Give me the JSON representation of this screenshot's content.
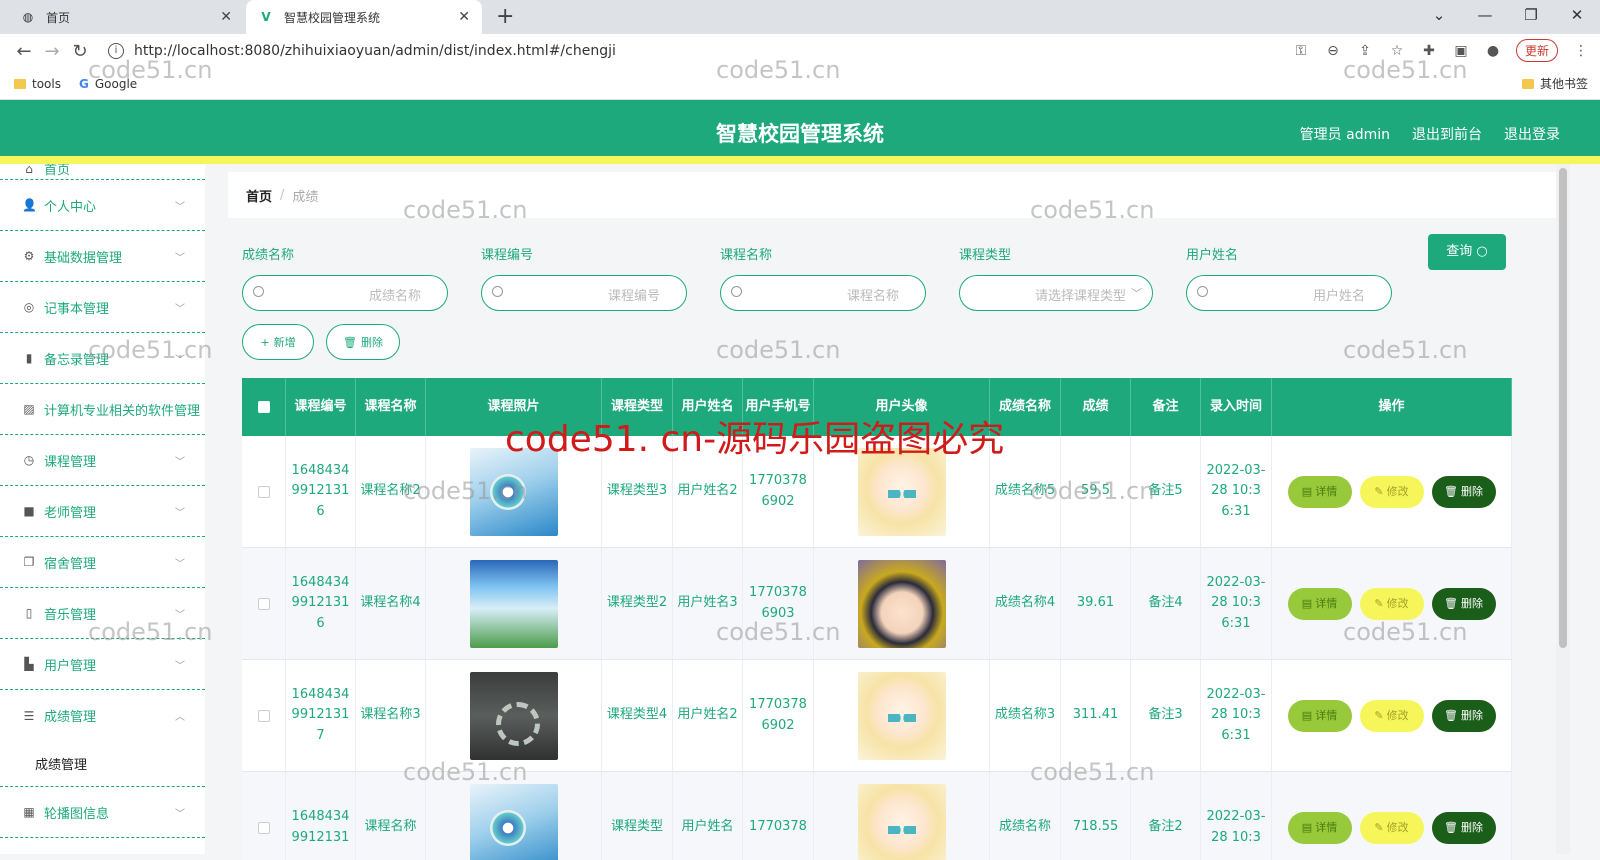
{
  "browser": {
    "tabs": [
      {
        "title": "首页",
        "icon": "globe-icon"
      },
      {
        "title": "智慧校园管理系统",
        "icon": "vue-logo-icon"
      }
    ],
    "url": "http://localhost:8080/zhihuixiaoyuan/admin/dist/index.html#/chengji",
    "update_label": "更新",
    "bookmarks": [
      {
        "label": "tools",
        "icon": "folder-icon"
      },
      {
        "label": "Google",
        "icon": "google-icon"
      }
    ],
    "other_bookmarks": "其他书签"
  },
  "header": {
    "title": "智慧校园管理系统",
    "links": [
      "管理员 admin",
      "退出到前台",
      "退出登录"
    ]
  },
  "sidebar": {
    "top_partial": "首页",
    "items": [
      {
        "label": "个人中心",
        "icon": "user-icon"
      },
      {
        "label": "基础数据管理",
        "icon": "gear-icon"
      },
      {
        "label": "记事本管理",
        "icon": "notebook-icon"
      },
      {
        "label": "备忘录管理",
        "icon": "bar-chart-icon"
      },
      {
        "label": "计算机专业相关的软件管理",
        "icon": "image-icon"
      },
      {
        "label": "课程管理",
        "icon": "clock-icon"
      },
      {
        "label": "老师管理",
        "icon": "camera-icon"
      },
      {
        "label": "宿舍管理",
        "icon": "copy-icon"
      },
      {
        "label": "音乐管理",
        "icon": "phone-icon"
      },
      {
        "label": "用户管理",
        "icon": "thumb-icon"
      },
      {
        "label": "成绩管理",
        "icon": "sliders-icon",
        "expanded": true
      },
      {
        "label": "轮播图信息",
        "icon": "grid-icon"
      }
    ],
    "sub_item": "成绩管理"
  },
  "breadcrumb": {
    "home": "首页",
    "sep": "/",
    "current": "成绩"
  },
  "search": {
    "fields": [
      {
        "label": "成绩名称",
        "placeholder": "成绩名称",
        "type": "text"
      },
      {
        "label": "课程编号",
        "placeholder": "课程编号",
        "type": "text"
      },
      {
        "label": "课程名称",
        "placeholder": "课程名称",
        "type": "text"
      },
      {
        "label": "课程类型",
        "placeholder": "请选择课程类型",
        "type": "select"
      },
      {
        "label": "用户姓名",
        "placeholder": "用户姓名",
        "type": "text"
      }
    ],
    "query_label": "查询"
  },
  "actions": {
    "add_label": "新增",
    "delete_label": "删除"
  },
  "table": {
    "headers": [
      "课程编号",
      "课程名称",
      "课程照片",
      "课程类型",
      "用户姓名",
      "用户手机号",
      "用户头像",
      "成绩名称",
      "成绩",
      "备注",
      "录入时间",
      "操作"
    ],
    "rows": [
      {
        "code": "16484349912131 6",
        "name": "课程名称2",
        "photo": "book",
        "type": "课程类型3",
        "user": "用户姓名2",
        "phone": "17703786902",
        "avatar": "avatar-blonde",
        "score_name": "成绩名称5",
        "score": "59.5",
        "note": "备注5",
        "time": "2022-03-28 10:36:31"
      },
      {
        "code": "16484349912131 6",
        "name": "课程名称4",
        "photo": "mathbook",
        "type": "课程类型2",
        "user": "用户姓名3",
        "phone": "17703786903",
        "avatar": "avatar-boy",
        "score_name": "成绩名称4",
        "score": "39.61",
        "note": "备注4",
        "time": "2022-03-28 10:36:31"
      },
      {
        "code": "16484349912131 7",
        "name": "课程名称3",
        "photo": "darkbook",
        "type": "课程类型4",
        "user": "用户姓名2",
        "phone": "17703786902",
        "avatar": "avatar-blonde",
        "score_name": "成绩名称3",
        "score": "311.41",
        "note": "备注3",
        "time": "2022-03-28 10:36:31"
      },
      {
        "code": "16484349912131",
        "name": "课程名称",
        "photo": "book",
        "type": "课程类型",
        "user": "用户姓名",
        "phone": "1770378",
        "avatar": "avatar-blonde",
        "score_name": "成绩名称",
        "score": "718.55",
        "note": "备注2",
        "time": "2022-03-28 10:3"
      }
    ],
    "op_labels": {
      "detail": "详情",
      "edit": "修改",
      "delete": "删除"
    }
  },
  "watermark": {
    "small": "code51.cn",
    "big": "code51. cn-源码乐园盗图必究"
  },
  "colors": {
    "primary": "#1ea97c",
    "accent_yellow": "#f6f65a",
    "detail_green": "#97c93a",
    "delete_dark": "#1b5e1a"
  }
}
